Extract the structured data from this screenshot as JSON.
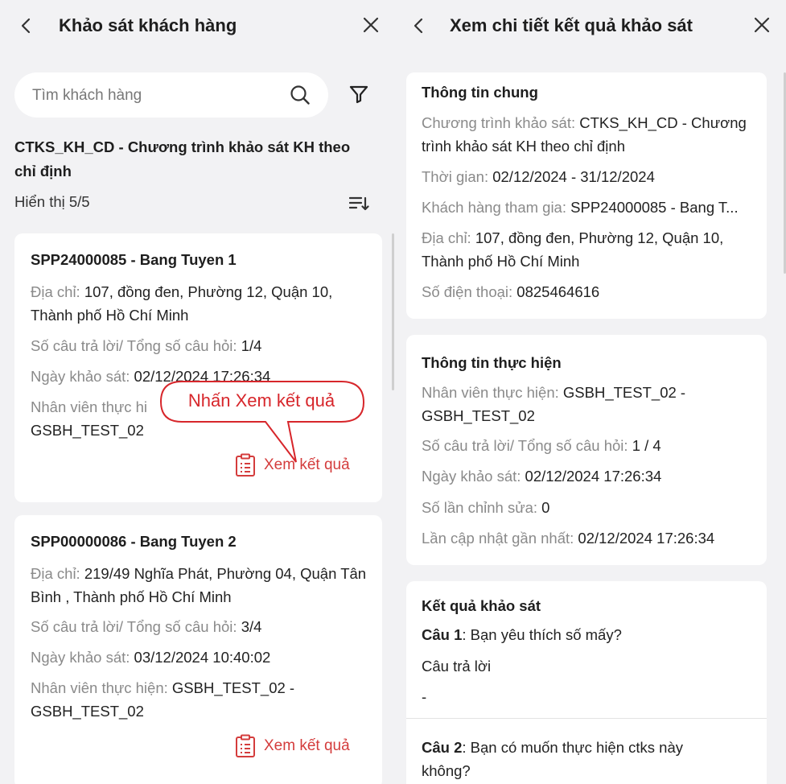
{
  "left": {
    "header": {
      "back_icon": "chevron-left-icon",
      "title": "Khảo sát khách hàng",
      "close_icon": "close-icon"
    },
    "search": {
      "placeholder": "Tìm khách hàng",
      "value": "",
      "icon": "search-icon"
    },
    "filter_icon": "filter-icon",
    "program_title": "CTKS_KH_CD - Chương trình khảo sát KH theo chỉ định",
    "count_text": "Hiển thị 5/5",
    "sort_icon": "sort-icon",
    "cards": [
      {
        "name": "SPP24000085 - Bang Tuyen 1",
        "address_label": "Địa chỉ:",
        "address": "107, đồng đen, Phường 12, Quận 10, Thành phố Hồ Chí Minh",
        "answers_label": "Số câu trả lời/ Tổng số câu hỏi:",
        "answers": "1/4",
        "date_label": "Ngày khảo sát:",
        "date": "02/12/2024 17:26:34",
        "staff_label": "Nhân viên thực hiện:",
        "staff": "GSBH_TEST_02 - GSBH_TEST_02",
        "staff_visible_label": "Nhân viên thực hi",
        "staff_visible_line2": "GSBH_TEST_02",
        "view_label": "Xem kết quả"
      },
      {
        "name": "SPP00000086 - Bang Tuyen 2",
        "address_label": "Địa chỉ:",
        "address": "219/49 Nghĩa Phát, Phường 04, Quận Tân Bình , Thành phố Hồ Chí Minh",
        "answers_label": "Số câu trả lời/ Tổng số câu hỏi:",
        "answers": "3/4",
        "date_label": "Ngày khảo sát:",
        "date": "03/12/2024 10:40:02",
        "staff_label": "Nhân viên thực hiện:",
        "staff": "GSBH_TEST_02 - GSBH_TEST_02",
        "view_label": "Xem kết quả"
      }
    ],
    "callout": "Nhấn Xem kết quả"
  },
  "right": {
    "header": {
      "back_icon": "chevron-left-icon",
      "title": "Xem chi tiết kết quả khảo sát",
      "close_icon": "close-icon"
    },
    "general": {
      "title": "Thông tin chung",
      "program_label": "Chương trình khảo sát:",
      "program": "CTKS_KH_CD - Chương trình khảo sát KH theo chỉ định",
      "time_label": "Thời gian:",
      "time": "02/12/2024 - 31/12/2024",
      "customer_label": "Khách hàng tham gia:",
      "customer": "SPP24000085 - Bang T...",
      "address_label": "Địa chỉ:",
      "address": "107, đồng đen, Phường 12, Quận 10, Thành phố Hồ Chí Minh",
      "phone_label": "Số điện thoại:",
      "phone": "0825464616"
    },
    "execution": {
      "title": "Thông tin thực hiện",
      "staff_label": "Nhân viên thực hiện:",
      "staff": "GSBH_TEST_02 - GSBH_TEST_02",
      "answers_label": "Số câu trả lời/ Tổng số câu hỏi:",
      "answers": "1 / 4",
      "date_label": "Ngày khảo sát:",
      "date": "02/12/2024 17:26:34",
      "edits_label": "Số lần chỉnh sửa:",
      "edits": "0",
      "updated_label": "Lần cập nhật gần nhất:",
      "updated": "02/12/2024 17:26:34"
    },
    "results": {
      "title": "Kết quả khảo sát",
      "q1_label": "Câu 1",
      "q1": ": Bạn yêu thích số mấy?",
      "answer_label": "Câu trả lời",
      "q1_answer": "-",
      "q2_label": "Câu 2",
      "q2": ": Bạn có muốn thực hiện ctks này không?"
    }
  },
  "colors": {
    "accent": "#d43c3c",
    "callout": "#d7262b",
    "background": "#f2f2f4",
    "card": "#ffffff"
  }
}
